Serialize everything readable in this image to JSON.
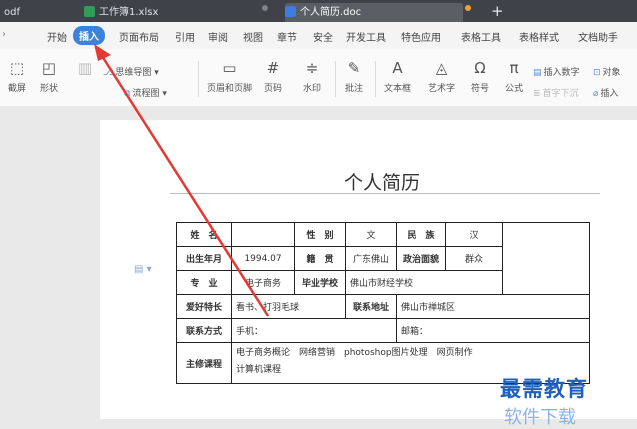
{
  "tabs": {
    "pdf": "odf",
    "xlsx": "工作簿1.xlsx",
    "doc": "个人简历.doc",
    "new_tab": "+"
  },
  "menu": [
    "开始",
    "插入",
    "页面布局",
    "引用",
    "审阅",
    "视图",
    "章节",
    "安全",
    "开发工具",
    "特色应用",
    "表格工具",
    "表格样式",
    "文档助手"
  ],
  "active_menu": "插入",
  "toolbar": {
    "screenshot": "截屏",
    "shape": "形状",
    "mindmap": "思维导图",
    "flowchart": "流程图",
    "header_footer": "页眉和页脚",
    "page_number": "页码",
    "watermark": "水印",
    "comment": "批注",
    "textbox": "文本框",
    "wordart": "艺术字",
    "symbol": "符号",
    "formula": "公式",
    "insert_number": "插入数字",
    "object": "对象",
    "drop_cap": "首字下沉",
    "insert_ref": "插入"
  },
  "document": {
    "title": "个人简历",
    "table": {
      "r1": [
        "姓　名",
        "",
        "性　别",
        "文",
        "民　族",
        "汉"
      ],
      "r2": [
        "出生年月",
        "1994.07",
        "籍　贯",
        "广东佛山",
        "政治面貌",
        "群众"
      ],
      "r3": [
        "专　业",
        "电子商务",
        "毕业学校",
        "佛山市财经学校"
      ],
      "r4": [
        "爱好特长",
        "看书、打羽毛球",
        "联系地址",
        "佛山市禅城区"
      ],
      "r5": [
        "联系方式",
        "手机：",
        "邮箱："
      ],
      "r6": [
        "主修课程",
        "电子商务概论　网络营销　photoshop图片处理　网页制作",
        "计算机课程"
      ]
    }
  },
  "watermark": {
    "text": "最需教育",
    "sub": "软件下载"
  },
  "colors": {
    "accent": "#3c82d8",
    "arrow": "#e53935",
    "tabbar": "#3f4349"
  }
}
